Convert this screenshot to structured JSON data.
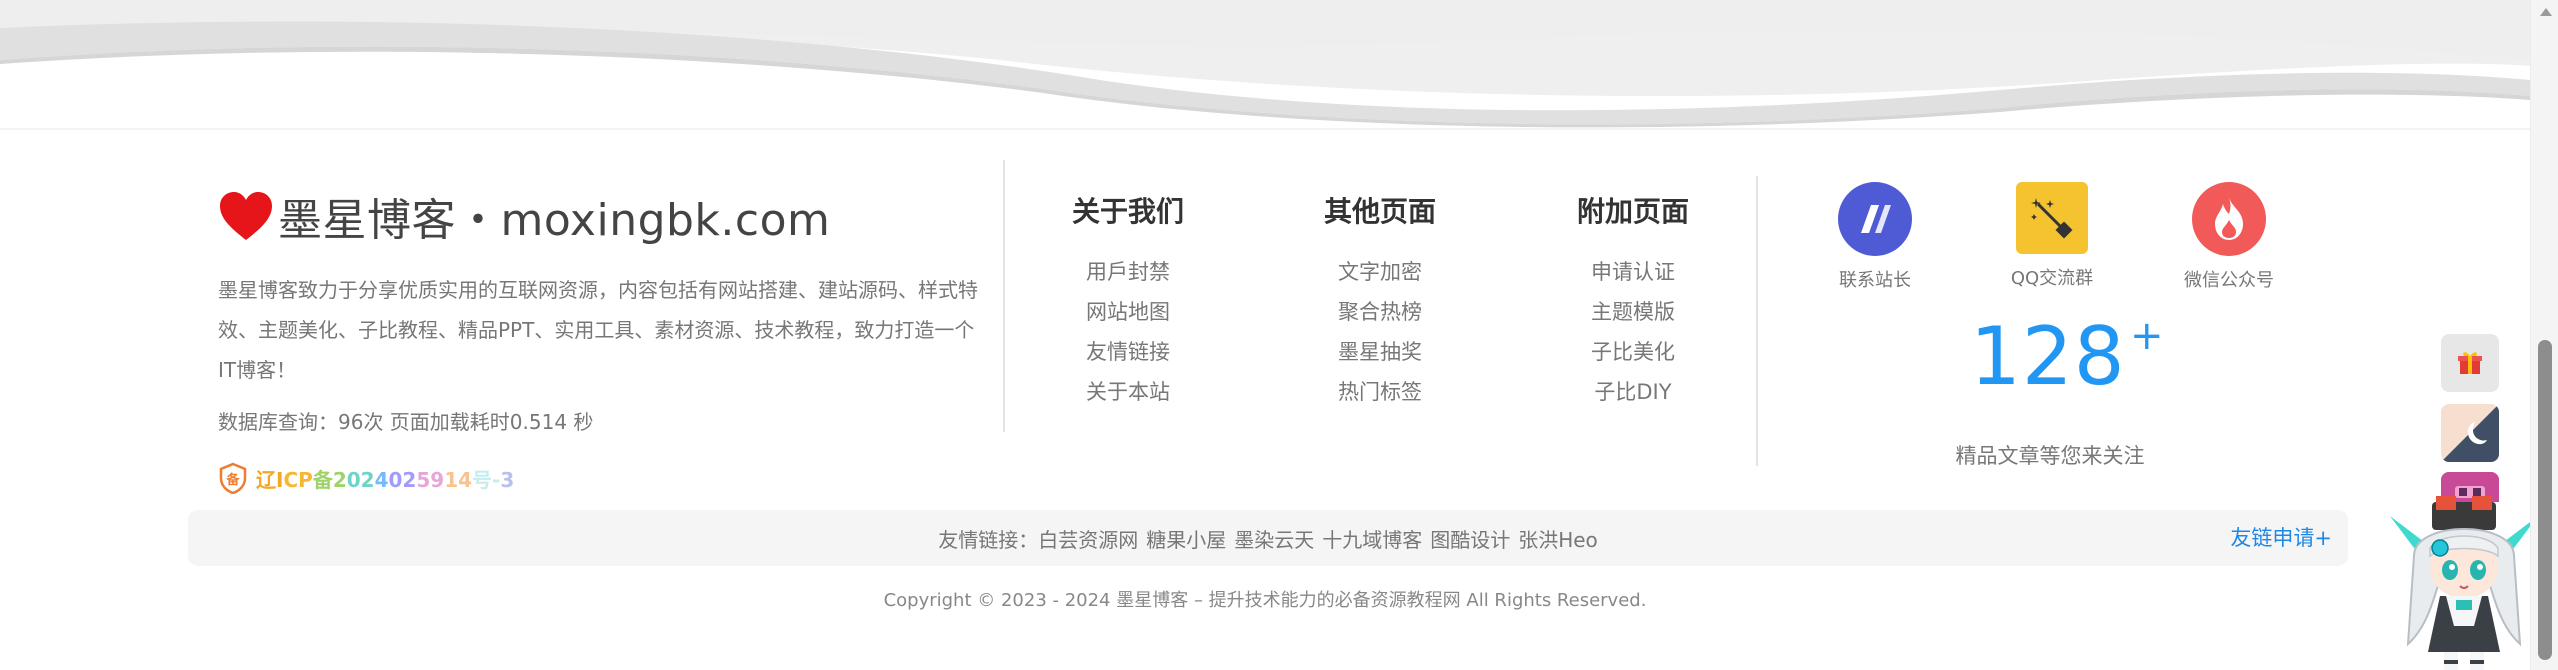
{
  "brand": {
    "title": "墨星博客・moxingbk.com",
    "heart_color": "#e5151a",
    "description": "墨星博客致力于分享优质实用的互联网资源，内容包括有网站搭建、建站源码、样式特效、主题美化、子比教程、精品PPT、实用工具、素材资源、技术教程，致力打造一个IT博客！",
    "stats": "数据库查询：96次 页面加载耗时0.514 秒",
    "icp_chars": [
      "辽",
      "I",
      "C",
      "P",
      "备",
      "2",
      "0",
      "2",
      "4",
      "0",
      "2",
      "5",
      "9",
      "1",
      "4",
      "号",
      "-",
      "3"
    ]
  },
  "menus": [
    {
      "title": "关于我们",
      "links": [
        "用戶封禁",
        "网站地图",
        "友情链接",
        "关于本站"
      ]
    },
    {
      "title": "其他页面",
      "links": [
        "文字加密",
        "聚合热榜",
        "墨星抽奖",
        "热门标签"
      ]
    },
    {
      "title": "附加页面",
      "links": [
        "申请认证",
        "主题模版",
        "子比美化",
        "子比DIY"
      ]
    }
  ],
  "contacts": [
    {
      "label": "联系站长",
      "icon": "contact-admin-icon",
      "color": "#4f5bd5"
    },
    {
      "label": "QQ交流群",
      "icon": "magic-wand-icon",
      "color": "#f5c230"
    },
    {
      "label": "微信公众号",
      "icon": "flame-icon",
      "color": "#f25a5a"
    }
  ],
  "articles": {
    "count": "128",
    "plus": "+",
    "caption": "精品文章等您来关注"
  },
  "friend_links": {
    "label": "友情链接：",
    "items": [
      "白芸资源网",
      "糖果小屋",
      "墨染云天",
      "十九域博客",
      "图酷设计",
      "张洪Heo"
    ],
    "apply": "友链申请+"
  },
  "copyright": "Copyright © 2023 - 2024 墨星博客 – 提升技术能力的必备资源教程网 All Rights Reserved.",
  "colors": {
    "accent": "#2196f3",
    "link_apply": "#1e88e5"
  }
}
